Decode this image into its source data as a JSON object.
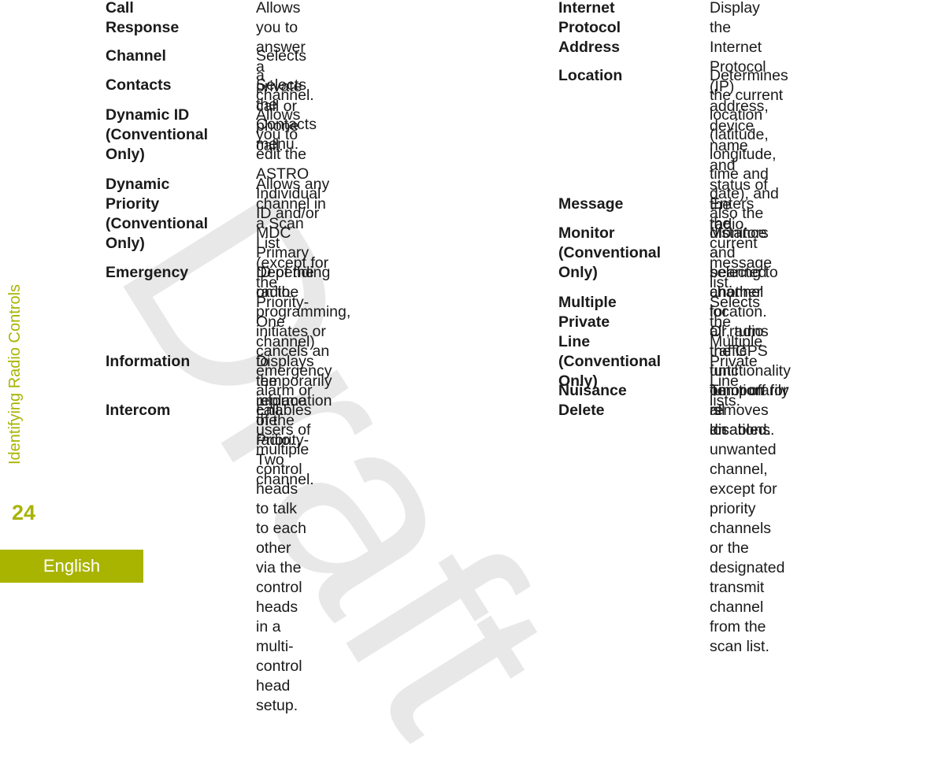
{
  "page": {
    "section_title": "Identifying Radio Controls",
    "page_number": "24",
    "language": "English",
    "watermark": "Draft"
  },
  "left_column": [
    {
      "term": "Call Response",
      "desc": "Allows you to answer a private\ncall or phone call."
    },
    {
      "term": "Channel",
      "desc": "Selects a channel."
    },
    {
      "term": "Contacts",
      "desc": "Selects the Contacts menu."
    },
    {
      "term": "Dynamic ID\n(Conventional\nOnly)",
      "desc": "Allows you to edit the ASTRO\nIndividual ID and/or MDC\nPrimary ID of the radio."
    },
    {
      "term": "Dynamic Priority\n(Conventional\nOnly)",
      "desc": "Allows any channel in a Scan\nList (except for the Priority-One\nchannel) to temporarily replace\nthe Priority-Two channel."
    },
    {
      "term": "Emergency",
      "desc": "Depending on the\nprogramming, initiates or\ncancels an emergency alarm or\ncall."
    },
    {
      "term": "Information",
      "desc": "Displays the information of the\nradio."
    },
    {
      "term": "Intercom",
      "desc": "Enables users of multiple\ncontrol heads to talk to each\nother via the control heads in a\nmulti-control head setup."
    }
  ],
  "right_column": [
    {
      "term": "Internet Protocol\nAddress",
      "desc": "Display the Internet Protocol\n(IP) address, device name and\nstatus of the radio."
    },
    {
      "term": "Location",
      "desc": "Determines the current location\n(latitude, longitude, time and\ndate), and also the distance\nand bearing to another location.\nOr, turns the GPS functionality\non or off for all locations."
    },
    {
      "term": "Message",
      "desc": "Enters the current message list."
    },
    {
      "term": "Monitor\n(Conventional\nOnly)",
      "desc": "Monitors a selected channel for\nall radio traffic until function is\ndisabled."
    },
    {
      "term": "Multiple Private\nLine\n(Conventional\nOnly)",
      "desc": "Selects the Multiple Private\nLine lists."
    },
    {
      "term": "Nuisance Delete",
      "desc": "Temporarily removes an\nunwanted channel, except for\npriority channels or the\ndesignated transmit channel\nfrom the scan list."
    }
  ]
}
